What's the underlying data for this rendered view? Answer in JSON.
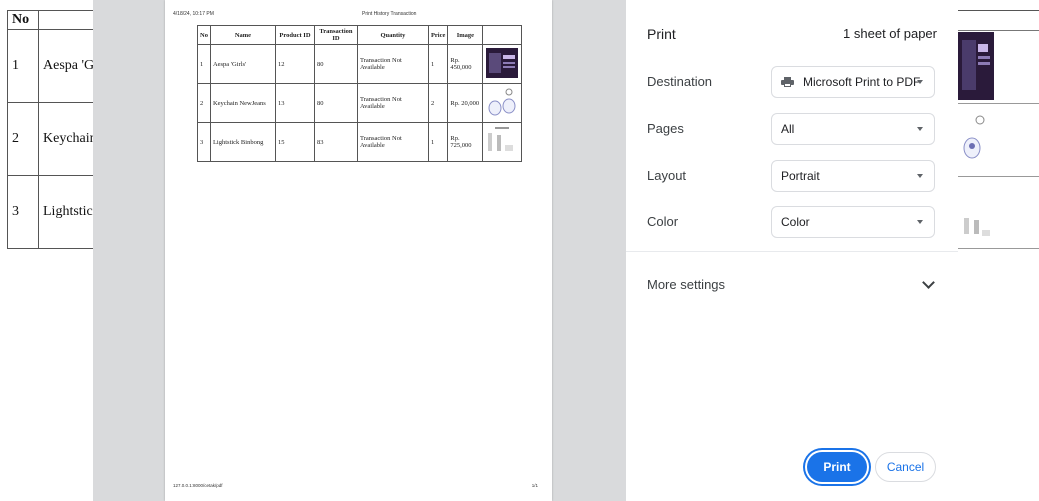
{
  "background_table": {
    "header_no": "No",
    "rows": [
      {
        "no": "1",
        "name": "Aespa 'Gi"
      },
      {
        "no": "2",
        "name": "Keychain"
      },
      {
        "no": "3",
        "name": "Lightstick"
      }
    ]
  },
  "preview": {
    "header_left": "4/18/24, 10:17 PM",
    "header_center": "Print History Transaction",
    "footer_left": "127.0.0.1:8000/cetak/pdf",
    "footer_right": "1/1",
    "columns": [
      "No",
      "Name",
      "Product ID",
      "Transaction ID",
      "Quantity",
      "Price",
      "Image"
    ],
    "rows": [
      {
        "no": "1",
        "name": "Aespa 'Girls'",
        "product_id": "12",
        "transaction_id": "80",
        "quantity": "Transaction Not Available",
        "qty_num": "1",
        "price": "Rp. 450,000"
      },
      {
        "no": "2",
        "name": "Keychain NewJeans",
        "product_id": "13",
        "transaction_id": "80",
        "quantity": "Transaction Not Available",
        "qty_num": "2",
        "price": "Rp. 20,000"
      },
      {
        "no": "3",
        "name": "Lightstick Binbong",
        "product_id": "15",
        "transaction_id": "83",
        "quantity": "Transaction Not Available",
        "qty_num": "1",
        "price": "Rp. 725,000"
      }
    ]
  },
  "print_panel": {
    "title": "Print",
    "sheet_count": "1 sheet of paper",
    "destination_label": "Destination",
    "destination_value": "Microsoft Print to PDF",
    "destination_icon": "printer-icon",
    "pages_label": "Pages",
    "pages_value": "All",
    "layout_label": "Layout",
    "layout_value": "Portrait",
    "color_label": "Color",
    "color_value": "Color",
    "more_settings": "More settings",
    "print_button": "Print",
    "cancel_button": "Cancel"
  },
  "colors": {
    "accent": "#1a73e8",
    "overlay": "#d9dadc"
  }
}
